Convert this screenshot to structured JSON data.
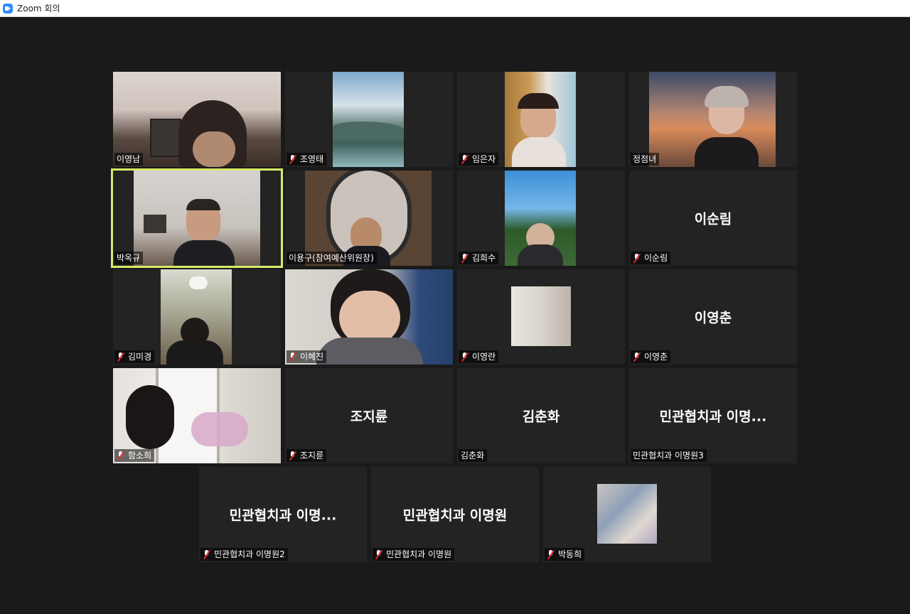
{
  "window": {
    "title": "Zoom 회의",
    "icon": "zoom-video-camera-icon"
  },
  "colors": {
    "background": "#1a1a1a",
    "tile": "#232323",
    "active_speaker": "#d8e86a",
    "muted": "#e02828"
  },
  "participants": [
    {
      "name": "이영남",
      "muted": false,
      "video": true,
      "active": false
    },
    {
      "name": "조영태",
      "muted": true,
      "video": true,
      "active": false
    },
    {
      "name": "임은자",
      "muted": true,
      "video": true,
      "active": false
    },
    {
      "name": "정점녀",
      "muted": false,
      "video": true,
      "active": false
    },
    {
      "name": "박옥규",
      "muted": false,
      "video": true,
      "active": true
    },
    {
      "name": "이용구(참여예산위원장)",
      "muted": false,
      "video": true,
      "active": false
    },
    {
      "name": "김희수",
      "muted": true,
      "video": true,
      "active": false
    },
    {
      "name": "이순림",
      "display": "이순림",
      "muted": true,
      "video": false,
      "active": false
    },
    {
      "name": "김미경",
      "muted": true,
      "video": true,
      "active": false
    },
    {
      "name": "이혜진",
      "muted": true,
      "video": true,
      "active": false
    },
    {
      "name": "이영란",
      "muted": true,
      "video": true,
      "active": false
    },
    {
      "name": "이영춘",
      "display": "이영춘",
      "muted": true,
      "video": false,
      "active": false
    },
    {
      "name": "함소희",
      "muted": true,
      "video": true,
      "active": false
    },
    {
      "name": "조지륜",
      "display": "조지륜",
      "muted": true,
      "video": false,
      "active": false
    },
    {
      "name": "김춘화",
      "display": "김춘화",
      "muted": false,
      "video": false,
      "active": false
    },
    {
      "name": "민관협치과 이명원3",
      "display": "민관협치과 이명...",
      "muted": false,
      "video": false,
      "active": false
    },
    {
      "name": "민관협치과 이명원2",
      "display": "민관협치과 이명...",
      "muted": true,
      "video": false,
      "active": false
    },
    {
      "name": "민관협치과 이명원",
      "display": "민관협치과 이명원",
      "muted": true,
      "video": false,
      "active": false
    },
    {
      "name": "박동희",
      "muted": true,
      "video": true,
      "active": false
    }
  ]
}
